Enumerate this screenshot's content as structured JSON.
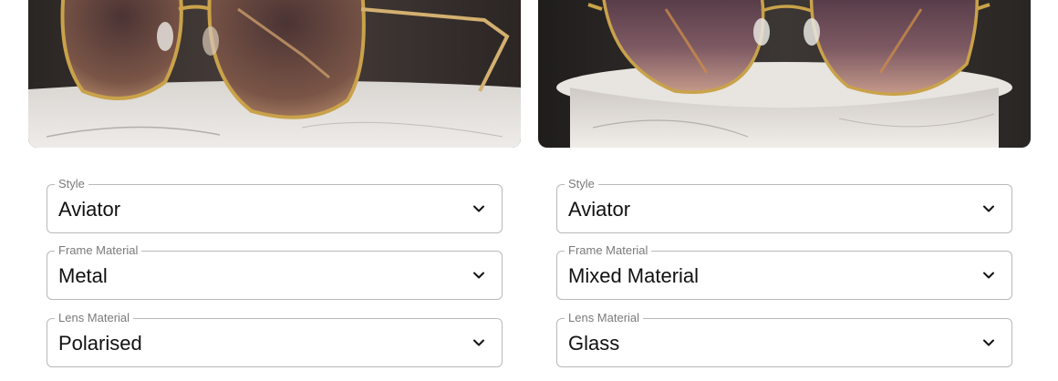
{
  "products": [
    {
      "image": {
        "subject": "sunglasses-on-marble-pedestal"
      },
      "fields": [
        {
          "label": "Style",
          "value": "Aviator"
        },
        {
          "label": "Frame Material",
          "value": "Metal"
        },
        {
          "label": "Lens Material",
          "value": "Polarised"
        }
      ]
    },
    {
      "image": {
        "subject": "sunglasses-on-marble-pedestal"
      },
      "fields": [
        {
          "label": "Style",
          "value": "Aviator"
        },
        {
          "label": "Frame Material",
          "value": "Mixed Material"
        },
        {
          "label": "Lens Material",
          "value": "Glass"
        }
      ]
    }
  ],
  "icons": {
    "dropdown": "chevron-down-icon"
  },
  "colors": {
    "border": "#b9b9b9",
    "label": "#7a7a7a",
    "frame_gold": "#c9a24a",
    "lens": "#6e4a46"
  }
}
